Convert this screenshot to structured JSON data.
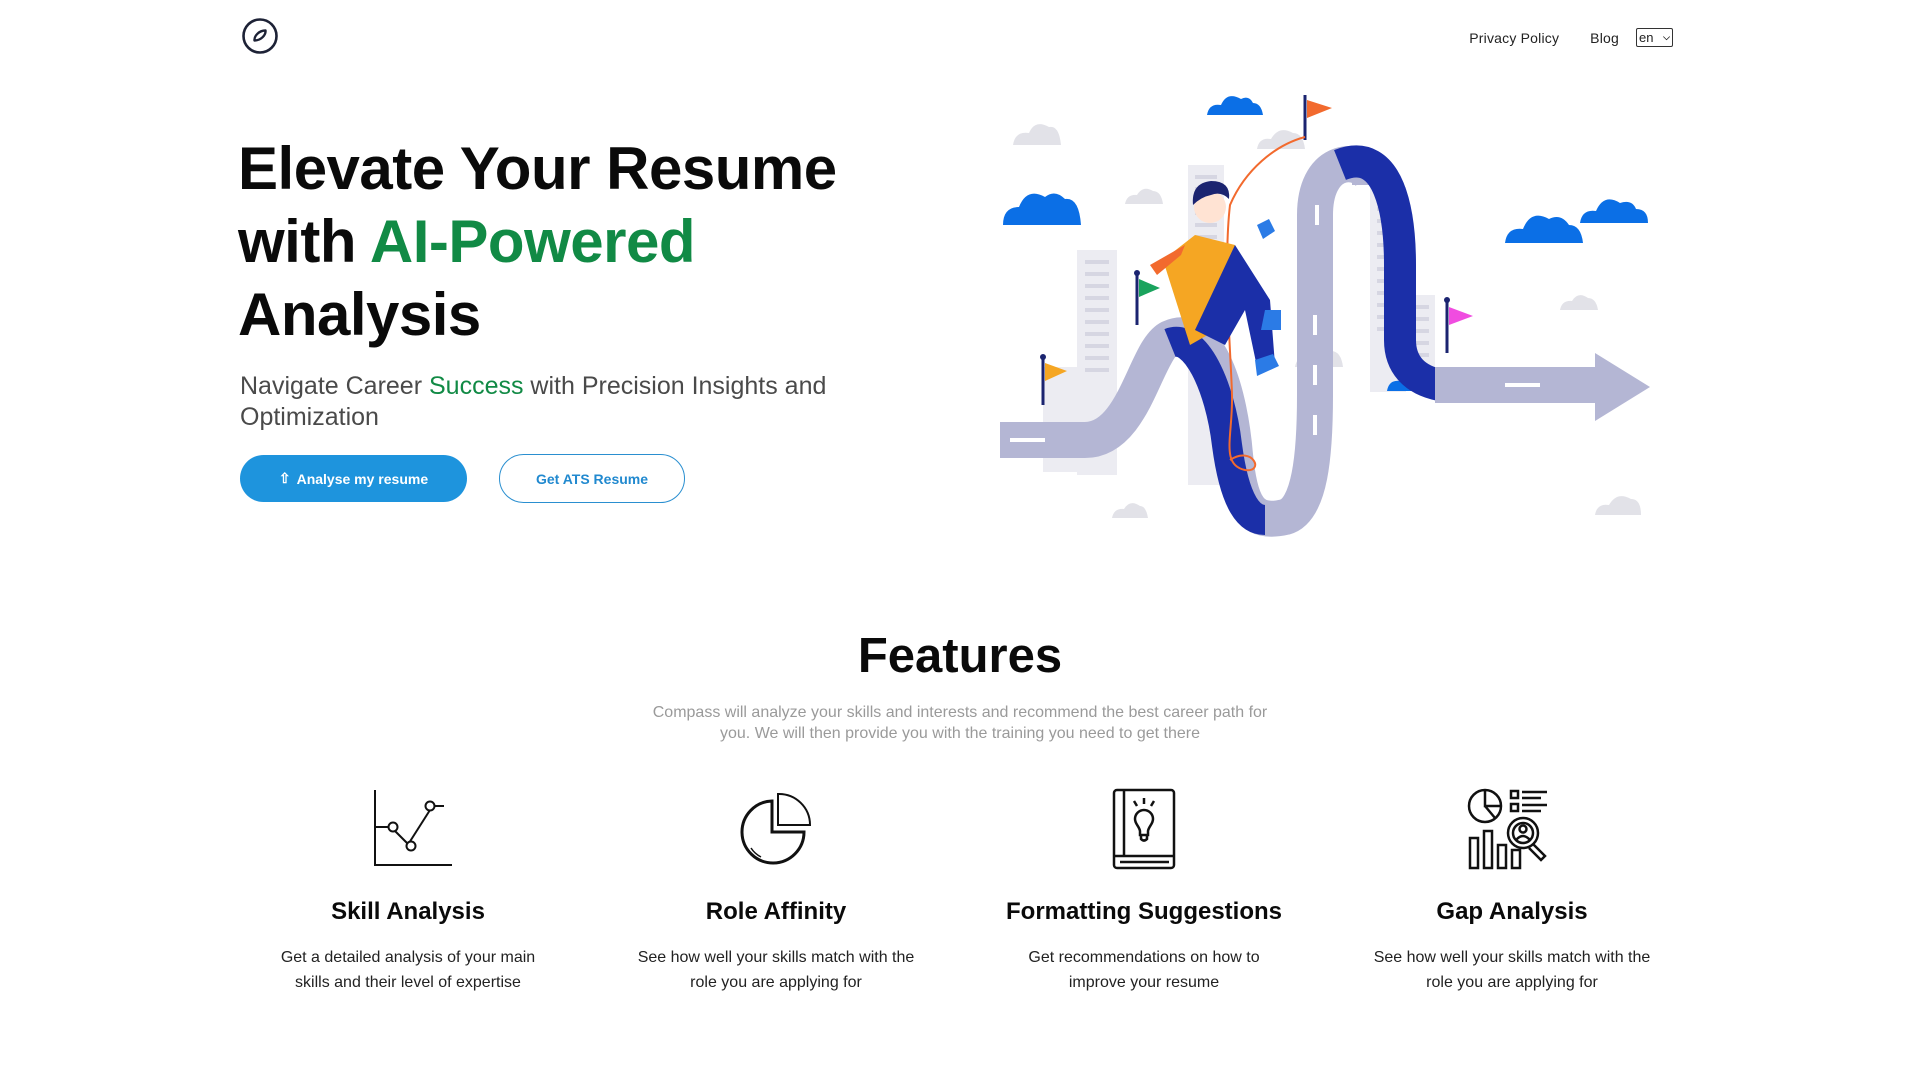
{
  "header": {
    "logo_icon": "compass-icon",
    "nav": [
      {
        "label": "Privacy Policy"
      },
      {
        "label": "Blog"
      }
    ],
    "language_select": {
      "selected": "en"
    }
  },
  "hero": {
    "title_line1": "Elevate Your Resume",
    "title_line2_prefix": "with ",
    "title_line2_accent": "AI-Powered",
    "title_line3": "Analysis",
    "subtitle_prefix": "Navigate Career ",
    "subtitle_accent": "Success",
    "subtitle_suffix": " with Precision Insights and Optimization",
    "primary_button": {
      "icon": "upload-arrow-icon",
      "icon_glyph": "⇧",
      "label": "Analyse my resume"
    },
    "secondary_button": {
      "label": "Get ATS Resume"
    },
    "illustration": "career-road-climber-illustration"
  },
  "colors": {
    "accent_green": "#118a45",
    "primary_blue": "#1e94dd",
    "road_navy": "#1b2fa8",
    "road_grey": "#b4b6d4",
    "cloud_blue": "#0b6fe6"
  },
  "features": {
    "title": "Features",
    "description": "Compass will analyze your skills and interests and recommend the best career path for you. We will then provide you with the training you need to get there",
    "items": [
      {
        "icon": "line-chart-icon",
        "title": "Skill Analysis",
        "description": "Get a detailed analysis of your main skills and their level of expertise"
      },
      {
        "icon": "pie-chart-icon",
        "title": "Role Affinity",
        "description": "See how well your skills match with the role you are applying for"
      },
      {
        "icon": "lightbulb-book-icon",
        "title": "Formatting Suggestions",
        "description": "Get recommendations on how to improve your resume"
      },
      {
        "icon": "data-analysis-search-icon",
        "title": "Gap Analysis",
        "description": "See how well your skills match with the role you are applying for"
      }
    ]
  }
}
